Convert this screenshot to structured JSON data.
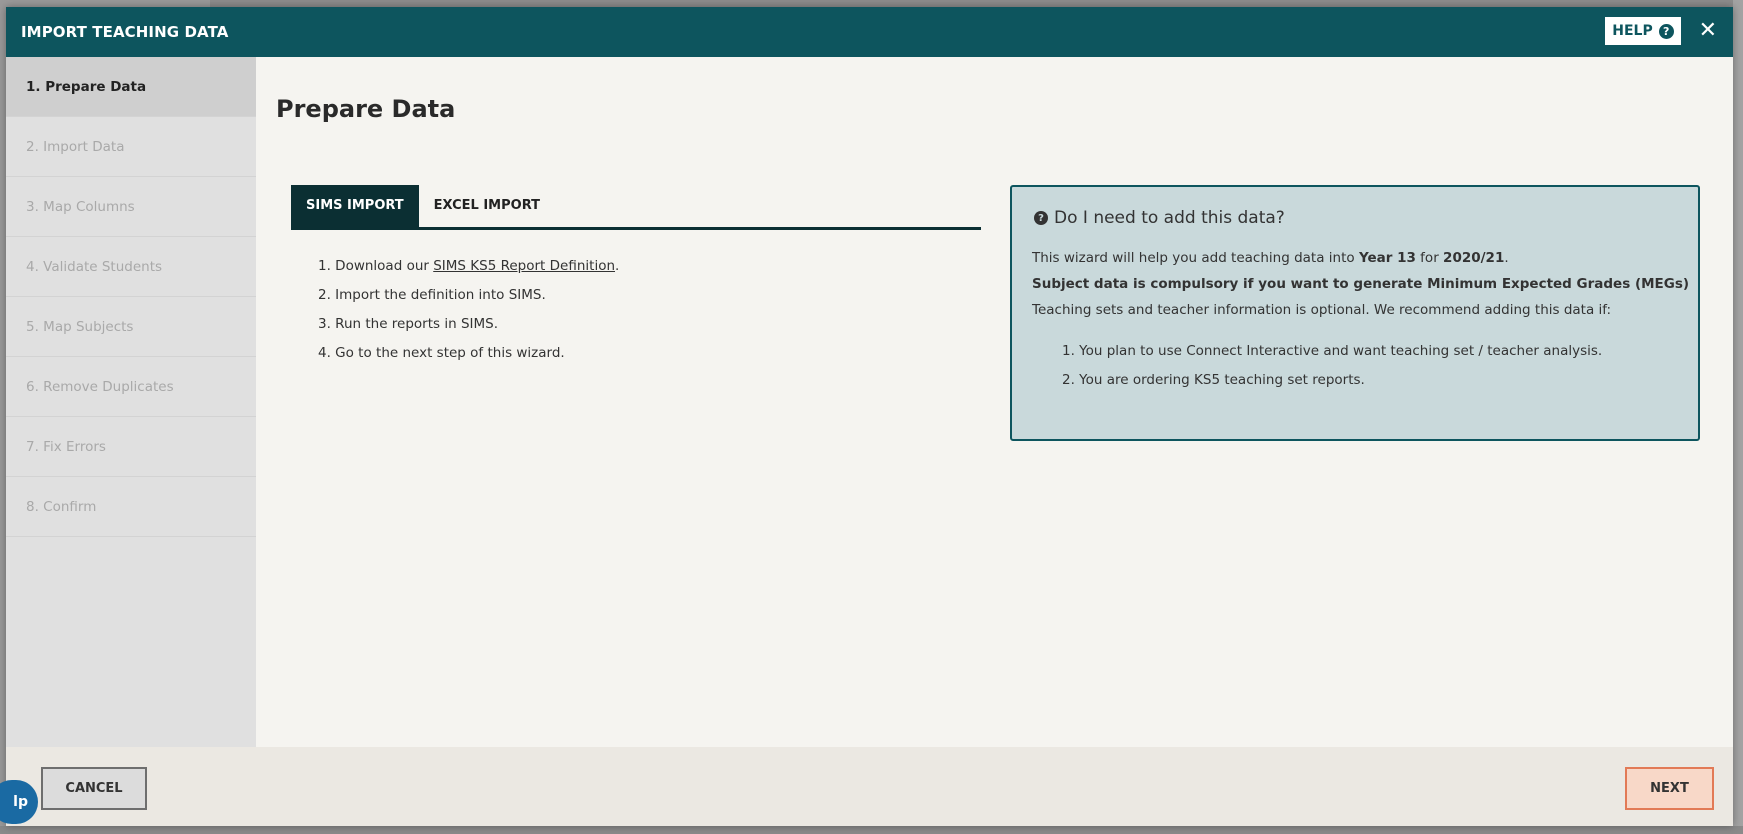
{
  "modal": {
    "title": "IMPORT TEACHING DATA",
    "help_label": "HELP",
    "close_glyph": "✕"
  },
  "sidebar": {
    "steps": [
      {
        "label": "1. Prepare Data",
        "active": true
      },
      {
        "label": "2. Import Data",
        "active": false
      },
      {
        "label": "3. Map Columns",
        "active": false
      },
      {
        "label": "4. Validate Students",
        "active": false
      },
      {
        "label": "5. Map Subjects",
        "active": false
      },
      {
        "label": "6. Remove Duplicates",
        "active": false
      },
      {
        "label": "7. Fix Errors",
        "active": false
      },
      {
        "label": "8. Confirm",
        "active": false
      }
    ]
  },
  "main": {
    "title": "Prepare Data",
    "tabs": [
      {
        "label": "SIMS IMPORT",
        "active": true
      },
      {
        "label": "EXCEL IMPORT",
        "active": false
      }
    ],
    "instructions": {
      "step1_prefix": "1. Download our ",
      "step1_link": "SIMS KS5 Report Definition",
      "step1_suffix": ".",
      "step2": "2. Import the definition into SIMS.",
      "step3": "3. Run the reports in SIMS.",
      "step4": "4. Go to the next step of this wizard."
    }
  },
  "info_box": {
    "title": "Do I need to add this data?",
    "line1_prefix": "This wizard will help you add teaching data into ",
    "line1_year": "Year 13",
    "line1_mid": " for ",
    "line1_period": "2020/21",
    "line1_suffix": ".",
    "line2": "Subject data is compulsory if you want to generate Minimum Expected Grades (MEGs)",
    "line3": "Teaching sets and teacher information is optional. We recommend adding this data if:",
    "items": [
      "1. You plan to use Connect Interactive and want teaching set / teacher analysis.",
      "2. You are ordering KS5 teaching set reports."
    ]
  },
  "footer": {
    "cancel_label": "CANCEL",
    "next_label": "NEXT"
  },
  "help_fab_label": "lp",
  "colors": {
    "header": "#0d555e",
    "tab_active": "#0b2f33",
    "info_bg": "#c9d9db",
    "next_border": "#e27a56"
  }
}
